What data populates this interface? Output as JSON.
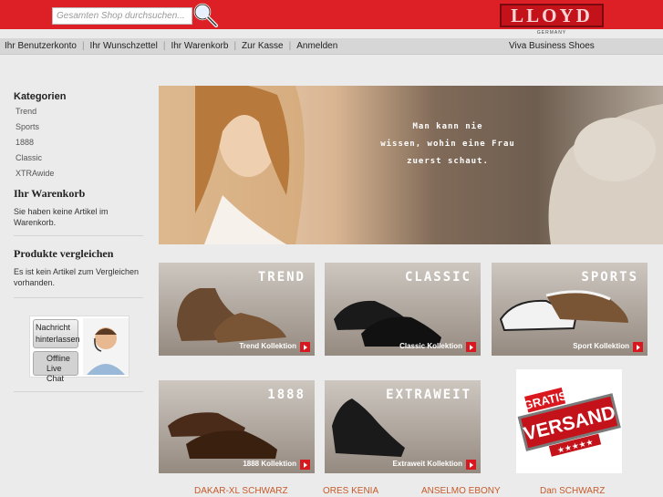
{
  "search": {
    "placeholder": "Gesamten Shop durchsuchen..."
  },
  "brand": {
    "logo": "LLOYD",
    "subtitle": "GERMANY"
  },
  "nav": {
    "links": [
      "Ihr Benutzerkonto",
      "Ihr Wunschzettel",
      "Ihr Warenkorb",
      "Zur Kasse",
      "Anmelden"
    ],
    "tagline": "Viva Business Shoes"
  },
  "sidebar": {
    "categories_title": "Kategorien",
    "categories": [
      "Trend",
      "Sports",
      "1888",
      "Classic",
      "XTRAwide"
    ],
    "cart_title": "Ihr Warenkorb",
    "cart_text": "Sie haben keine Artikel im Warenkorb.",
    "compare_title": "Produkte vergleichen",
    "compare_text": "Es ist kein Artikel zum Vergleichen vorhanden.",
    "chat": {
      "line1": "Nachricht",
      "line2": "hinterlassen",
      "status1": "Offline",
      "status2": "Live Chat"
    }
  },
  "hero": {
    "line1": "Man kann nie",
    "line2": "wissen, wohin eine Frau",
    "line3": "zuerst schaut."
  },
  "tiles": [
    {
      "title": "TREND",
      "caption": "Trend Kollektion"
    },
    {
      "title": "CLASSIC",
      "caption": "Classic Kollektion"
    },
    {
      "title": "SPORTS",
      "caption": "Sport Kollektion"
    },
    {
      "title": "1888",
      "caption": "1888 Kollektion"
    },
    {
      "title": "EXTRAWEIT",
      "caption": "Extraweit Kollektion"
    }
  ],
  "badge": {
    "line1": "GRATIS",
    "line2": "VERSAND"
  },
  "products": [
    "DAKAR-XL SCHWARZ",
    "ORES KENIA",
    "ANSELMO EBONY",
    "Dan SCHWARZ"
  ],
  "colors": {
    "brand_red": "#dd1f26",
    "product_link": "#c75a2a",
    "nav_bg": "#d6d6d6"
  }
}
